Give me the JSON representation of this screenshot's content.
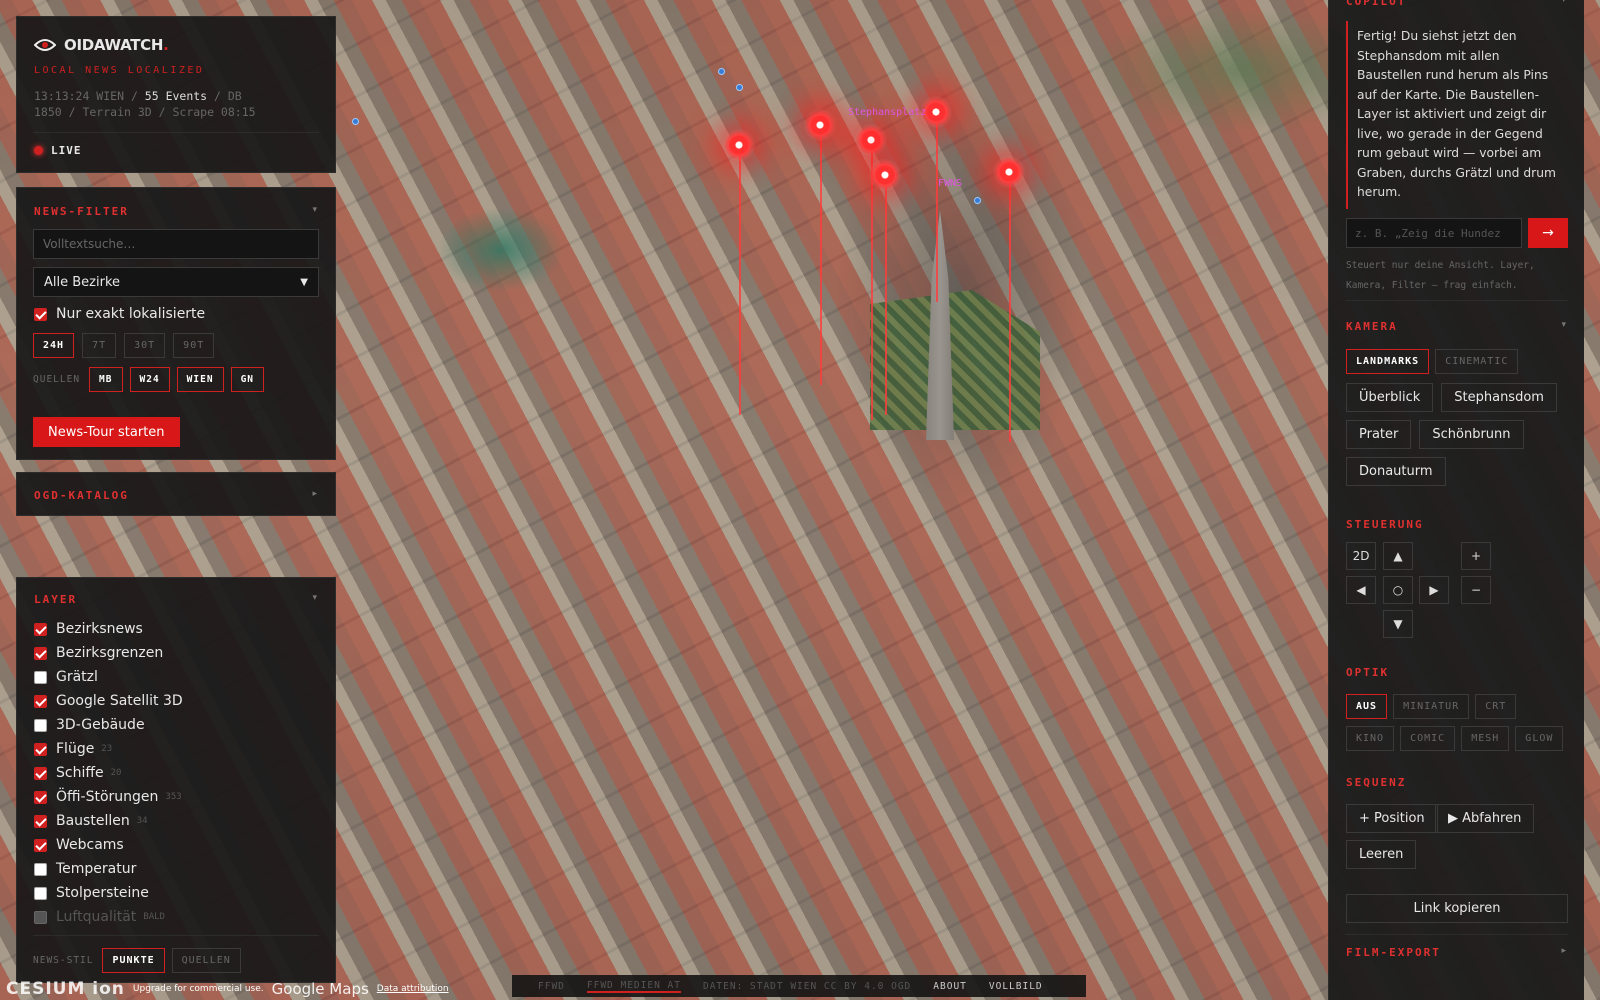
{
  "app": {
    "name": "OIDAWATCH",
    "subtitle": "LOCAL NEWS LOCALIZED",
    "time": "13:13:24 WIEN",
    "sep1": " / ",
    "events": "55 Events",
    "db": " / DB",
    "status2": "1850 / Terrain 3D / Scrape 08:15",
    "live": "LIVE"
  },
  "filter": {
    "title": "NEWS-FILTER",
    "search_placeholder": "Volltextsuche…",
    "district": "Alle Bezirke",
    "exact": "Nur exakt lokalisierte",
    "ranges": [
      "24H",
      "7T",
      "30T",
      "90T"
    ],
    "range_active": "24H",
    "sources_label": "QUELLEN",
    "sources": [
      "MB",
      "W24",
      "WIEN",
      "GN"
    ],
    "tour": "News-Tour starten"
  },
  "ogd": {
    "title": "OGD-KATALOG"
  },
  "layer": {
    "title": "LAYER",
    "items": [
      {
        "label": "Bezirksnews",
        "state": "on",
        "count": ""
      },
      {
        "label": "Bezirksgrenzen",
        "state": "on",
        "count": ""
      },
      {
        "label": "Grätzl",
        "state": "off",
        "count": ""
      },
      {
        "label": "Google Satellit 3D",
        "state": "on",
        "count": ""
      },
      {
        "label": "3D-Gebäude",
        "state": "off",
        "count": ""
      },
      {
        "label": "Flüge",
        "state": "on",
        "count": "23"
      },
      {
        "label": "Schiffe",
        "state": "on",
        "count": "20"
      },
      {
        "label": "Öffi-Störungen",
        "state": "on",
        "count": "353"
      },
      {
        "label": "Baustellen",
        "state": "on",
        "count": "34"
      },
      {
        "label": "Webcams",
        "state": "on",
        "count": ""
      },
      {
        "label": "Temperatur",
        "state": "off",
        "count": ""
      },
      {
        "label": "Stolpersteine",
        "state": "off",
        "count": ""
      },
      {
        "label": "Luftqualität",
        "state": "dis",
        "count": "BALD"
      }
    ],
    "style_label": "NEWS-STIL",
    "styles": [
      "PUNKTE",
      "QUELLEN"
    ],
    "style_active": "PUNKTE"
  },
  "copilot": {
    "title": "COPILOT",
    "message": "Fertig! Du siehst jetzt den Stephansdom mit allen Baustellen rund herum als Pins auf der Karte. Die Baustellen-Layer ist aktiviert und zeigt dir live, wo gerade in der Gegend rum gebaut wird — vorbei am Graben, durchs Grätzl und drum herum.",
    "input_placeholder": "z. B. „Zeig die Hundez",
    "send": "→",
    "hint": "Steuert nur deine Ansicht. Layer, Kamera, Filter — frag einfach."
  },
  "kamera": {
    "title": "KAMERA",
    "modes": [
      "LANDMARKS",
      "CINEMATIC"
    ],
    "mode_active": "LANDMARKS",
    "places": [
      "Überblick",
      "Stephansdom",
      "Prater",
      "Schönbrunn",
      "Donauturm"
    ]
  },
  "steuerung": {
    "title": "STEUERUNG",
    "b2d": "2D",
    "up": "▲",
    "down": "▼",
    "left": "◀",
    "right": "▶",
    "center": "○",
    "plus": "+",
    "minus": "−"
  },
  "optik": {
    "title": "OPTIK",
    "row1": [
      "AUS",
      "MINIATUR",
      "CRT"
    ],
    "row2": [
      "KINO",
      "COMIC",
      "MESH",
      "GLOW"
    ],
    "active": "AUS"
  },
  "sequenz": {
    "title": "SEQUENZ",
    "add": "+ Position",
    "play": "▶ Abfahren",
    "clear": "Leeren"
  },
  "link": "Link kopieren",
  "film": {
    "title": "FILM-EXPORT"
  },
  "map_labels": {
    "l1": "Stephansplatz",
    "l2": "FWNS"
  },
  "footer": {
    "cesium": "CESIUM ion",
    "upgrade": "Upgrade for commercial use.",
    "google": "Google Maps",
    "attrib": "Data attribution",
    "ticker": [
      "FFWD",
      "FFWD MEDIEN AT",
      "DATEN: STADT WIEN CC BY 4.0 OGD",
      "ABOUT",
      "VOLLBILD"
    ]
  },
  "colors": {
    "accent": "#d02020",
    "panel": "#181818"
  }
}
